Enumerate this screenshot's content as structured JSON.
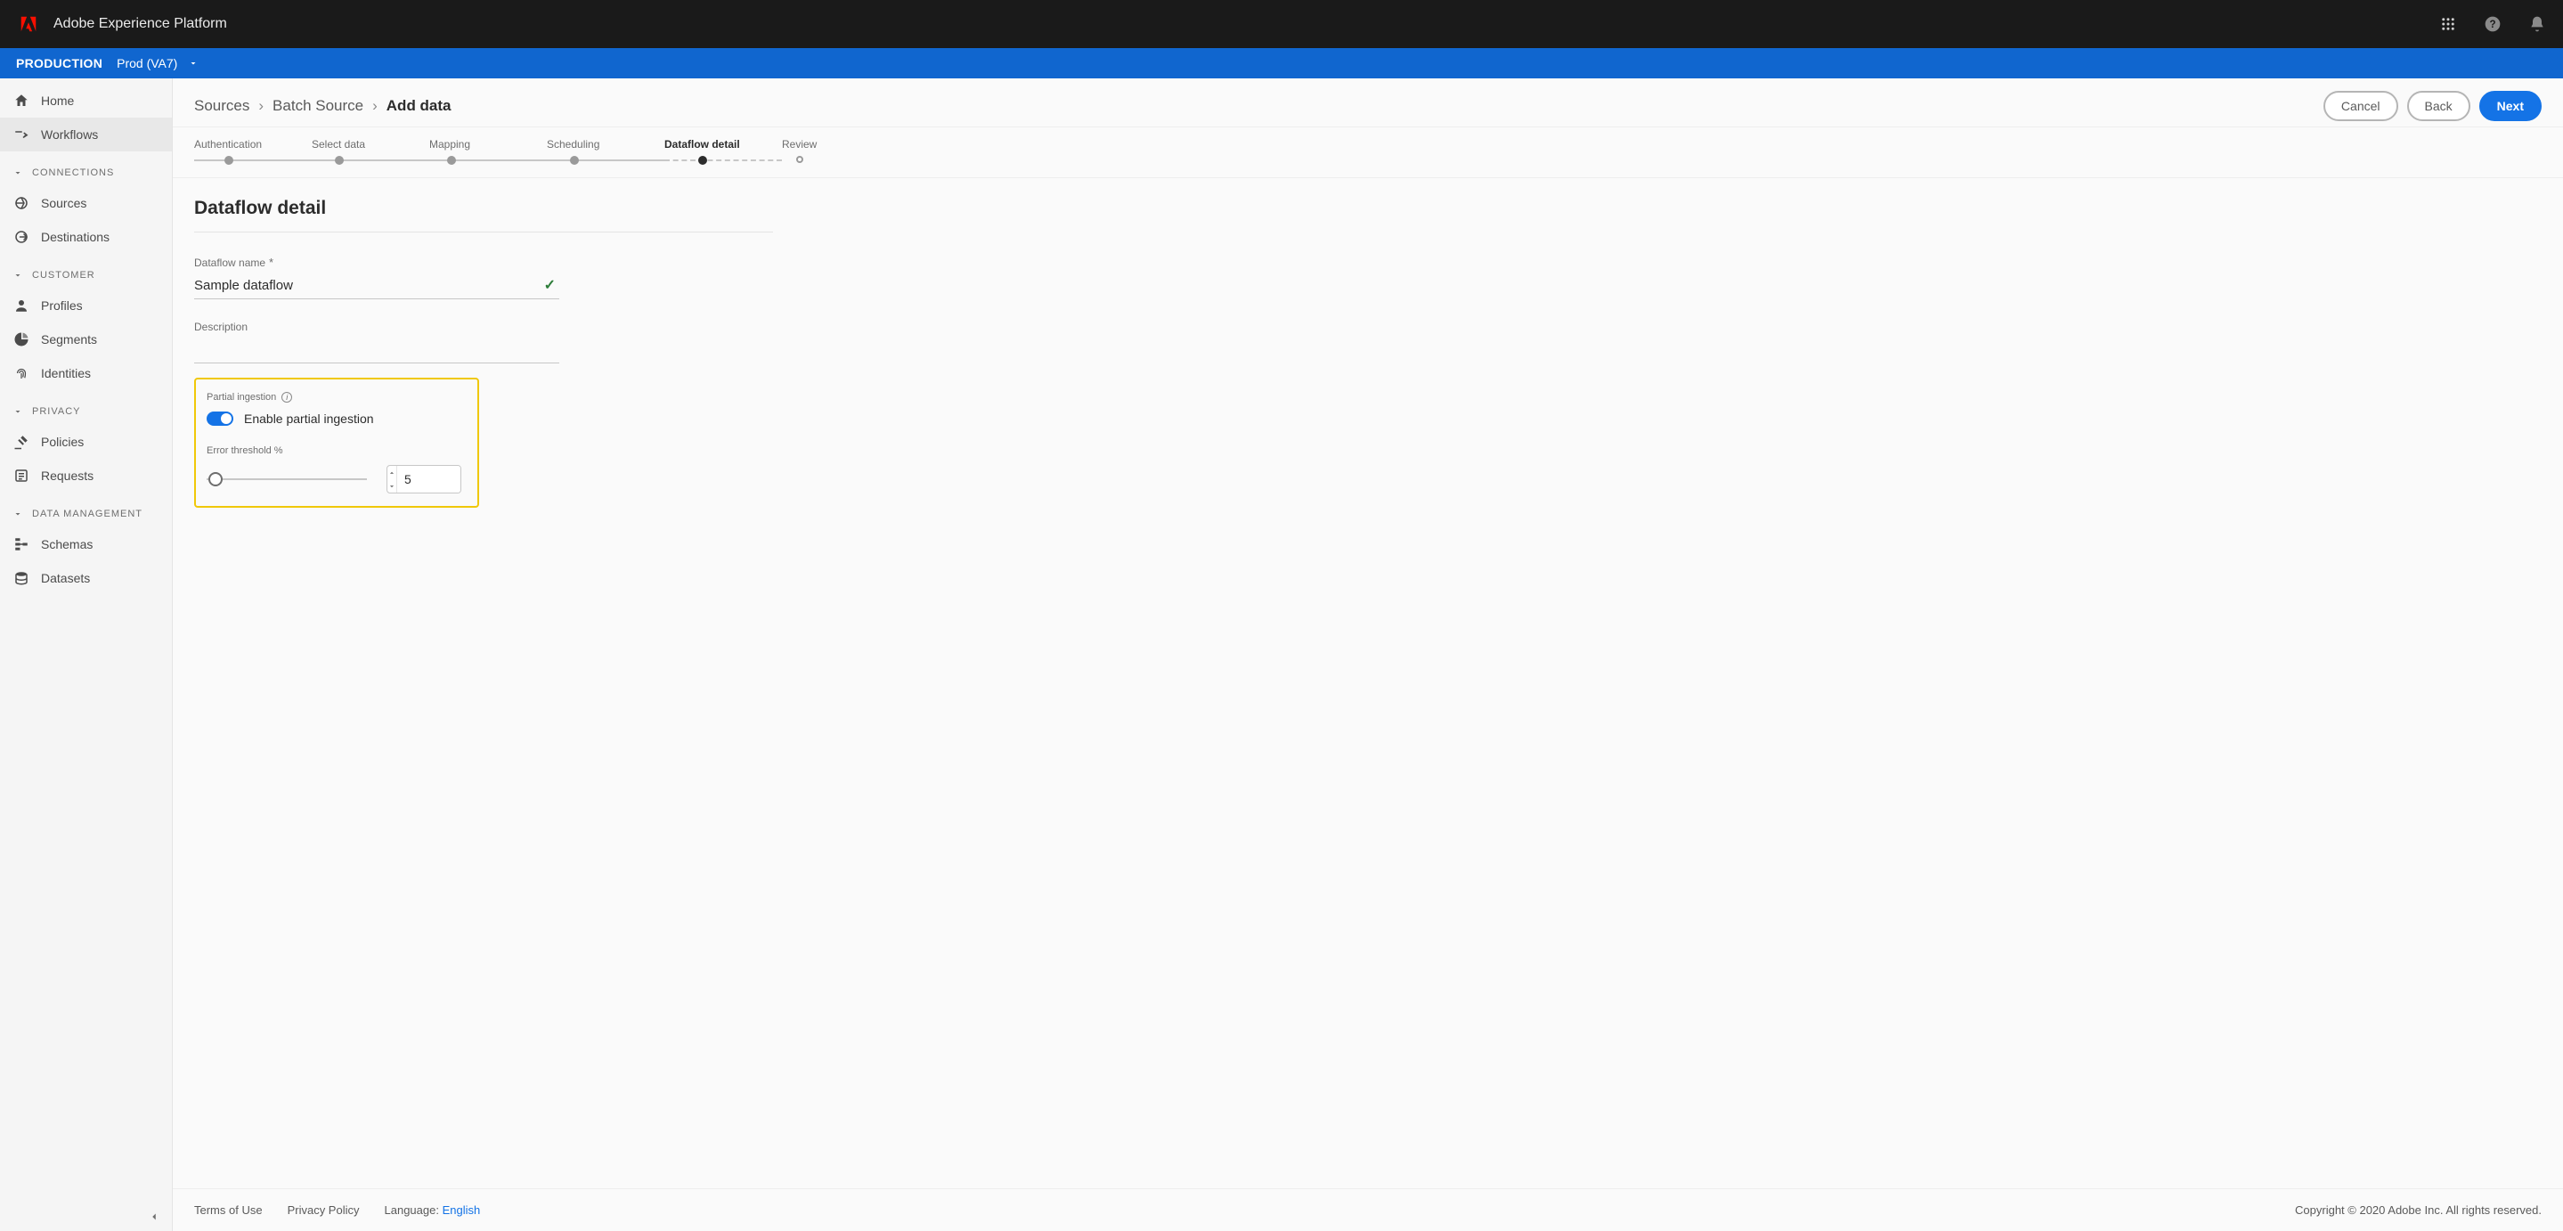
{
  "topbar": {
    "product_name": "Adobe Experience Platform"
  },
  "envbar": {
    "label": "PRODUCTION",
    "selected": "Prod (VA7)"
  },
  "sidebar": {
    "home": "Home",
    "workflows": "Workflows",
    "sections": {
      "connections": {
        "title": "CONNECTIONS",
        "items": [
          "Sources",
          "Destinations"
        ]
      },
      "customer": {
        "title": "CUSTOMER",
        "items": [
          "Profiles",
          "Segments",
          "Identities"
        ]
      },
      "privacy": {
        "title": "PRIVACY",
        "items": [
          "Policies",
          "Requests"
        ]
      },
      "data_mgmt": {
        "title": "DATA MANAGEMENT",
        "items": [
          "Schemas",
          "Datasets"
        ]
      }
    }
  },
  "header": {
    "breadcrumb": {
      "a": "Sources",
      "b": "Batch Source",
      "c": "Add data"
    },
    "buttons": {
      "cancel": "Cancel",
      "back": "Back",
      "next": "Next"
    }
  },
  "stepper": {
    "steps": [
      "Authentication",
      "Select data",
      "Mapping",
      "Scheduling",
      "Dataflow detail",
      "Review"
    ],
    "active_index": 4
  },
  "page": {
    "title": "Dataflow detail",
    "dataflow_name_label": "Dataflow name",
    "dataflow_name_value": "Sample dataflow",
    "description_label": "Description",
    "description_value": "",
    "partial_ingestion_label": "Partial ingestion",
    "partial_ingestion_toggle_label": "Enable partial ingestion",
    "partial_ingestion_enabled": true,
    "error_threshold_label": "Error threshold %",
    "error_threshold_value": "5"
  },
  "footer": {
    "terms": "Terms of Use",
    "privacy": "Privacy Policy",
    "lang_label": "Language: ",
    "lang_value": "English",
    "copyright": "Copyright  ©  2020 Adobe Inc.  All rights reserved."
  }
}
